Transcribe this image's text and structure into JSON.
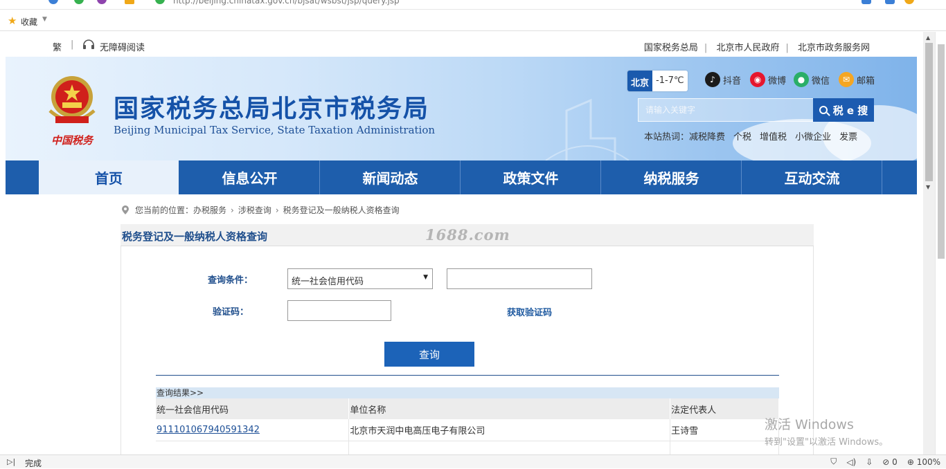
{
  "browser": {
    "url": "http://beijing.chinatax.gov.cn/bjsat/wsbst/jsp/query.jsp",
    "favorites_label": "收藏",
    "status_text": "完成",
    "zoom": "100%",
    "blocked_count": "0"
  },
  "toplinks": {
    "traditional": "繁",
    "accessible": "无障碍阅读",
    "links": [
      "国家税务总局",
      "北京市人民政府",
      "北京市政务服务网"
    ]
  },
  "banner": {
    "title_cn": "国家税务总局北京市税务局",
    "title_en": "Beijing Municipal Tax Service, State Taxation Administration",
    "emblem_caption": "中国税务",
    "weather_city": "北京",
    "weather_temp": "-1-7℃",
    "social": [
      {
        "label": "抖音",
        "color": "#1b1b1b",
        "glyph": "♪"
      },
      {
        "label": "微博",
        "color": "#e6162d",
        "glyph": "◉"
      },
      {
        "label": "微信",
        "color": "#2aae67",
        "glyph": "●"
      },
      {
        "label": "邮箱",
        "color": "#f5a623",
        "glyph": "✉"
      }
    ],
    "search_placeholder": "请输入关键字",
    "search_button": "税 e 搜",
    "hot_label": "本站热词：",
    "hot_words": [
      "减税降费",
      "个税",
      "增值税",
      "小微企业",
      "发票"
    ]
  },
  "nav": {
    "items": [
      "首页",
      "信息公开",
      "新闻动态",
      "政策文件",
      "纳税服务",
      "互动交流"
    ],
    "active_index": 0
  },
  "breadcrumb": {
    "prefix": "您当前的位置：",
    "items": [
      "办税服务",
      "涉税查询",
      "税务登记及一般纳税人资格查询"
    ]
  },
  "panel": {
    "title": "税务登记及一般纳税人资格查询",
    "watermark": "1688.com"
  },
  "form": {
    "condition_label": "查询条件：",
    "condition_selected": "统一社会信用代码",
    "condition_value": "",
    "captcha_label": "验证码：",
    "captcha_value": "",
    "get_captcha": "获取验证码",
    "query_button": "查询"
  },
  "results": {
    "header": "查询结果>>",
    "columns": [
      "统一社会信用代码",
      "单位名称",
      "法定代表人"
    ],
    "rows": [
      [
        "911101067940591342",
        "北京市天润中电高压电子有限公司",
        "王诗雪"
      ]
    ]
  },
  "os_watermark": {
    "line1": "激活 Windows",
    "line2": "转到\"设置\"以激活 Windows。"
  },
  "colors": {
    "nav_bg": "#1e5eac",
    "title_blue": "#1552a8",
    "button_blue": "#1c63b8"
  }
}
